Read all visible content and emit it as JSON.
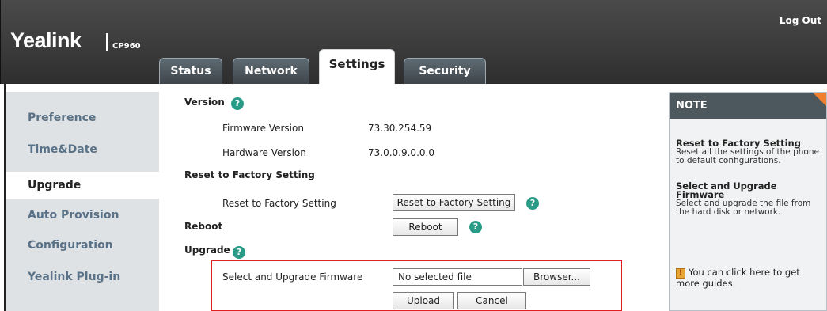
{
  "header": {
    "logo_text": "Yealink",
    "model": "CP960",
    "logout": "Log Out"
  },
  "tabs": [
    {
      "label": "Status",
      "active": false
    },
    {
      "label": "Network",
      "active": false
    },
    {
      "label": "Settings",
      "active": true
    },
    {
      "label": "Security",
      "active": false
    }
  ],
  "sidebar": {
    "items": [
      {
        "label": "Preference",
        "active": false
      },
      {
        "label": "Time&Date",
        "active": false
      },
      {
        "label": "Upgrade",
        "active": true
      },
      {
        "label": "Auto Provision",
        "active": false
      },
      {
        "label": "Configuration",
        "active": false
      },
      {
        "label": "Yealink Plug-in",
        "active": false
      }
    ]
  },
  "form": {
    "version_title": "Version",
    "firmware_label": "Firmware Version",
    "firmware_value": "73.30.254.59",
    "hardware_label": "Hardware Version",
    "hardware_value": "73.0.0.9.0.0.0",
    "reset_title": "Reset to Factory Setting",
    "reset_label": "Reset to Factory Setting",
    "reset_button": "Reset to Factory Setting",
    "reboot_title": "Reboot",
    "reboot_button": "Reboot",
    "upgrade_title": "Upgrade",
    "select_label": "Select and Upgrade Firmware",
    "file_value": "No selected file",
    "browse_button": "Browser...",
    "upload_button": "Upload",
    "cancel_button": "Cancel",
    "help_glyph": "?",
    "highlight_color": "#e02020"
  },
  "note": {
    "title": "NOTE",
    "reset_heading": "Reset to Factory Setting",
    "reset_text": "Reset all the settings of the phone to default configurations.",
    "upgrade_heading": "Select and Upgrade Firmware",
    "upgrade_text": "Select and upgrade the file from the hard disk or network.",
    "guide_text": "You can click here to get more guides.",
    "guide_icon": "book-icon"
  },
  "colors": {
    "header_bg": "#3a3a3a",
    "sidebar_bg": "#dfe2e5",
    "sidebar_text": "#5a7287",
    "help_icon": "#2a9b87",
    "note_header": "#4d575e",
    "note_flag": "#f08030"
  }
}
